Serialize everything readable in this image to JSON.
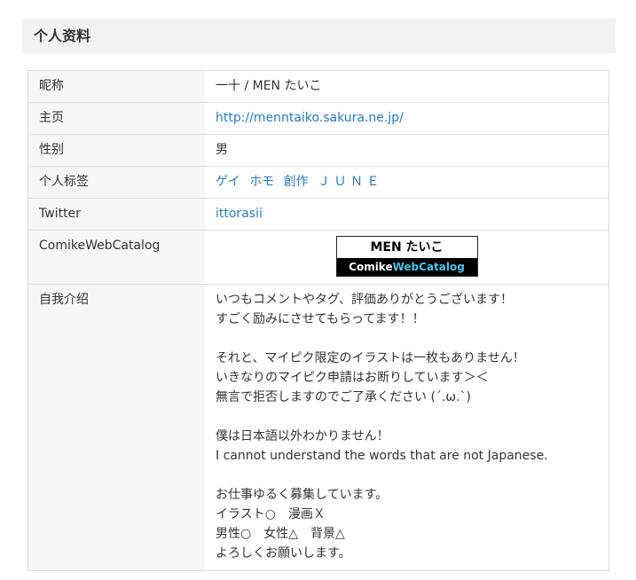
{
  "section": {
    "title": "个人资料"
  },
  "profile": {
    "nickname_label": "昵称",
    "nickname_value": "一十 / MEN たいこ",
    "homepage_label": "主页",
    "homepage_value": "http://menntaiko.sakura.ne.jp/",
    "gender_label": "性别",
    "gender_value": "男",
    "tags_label": "个人标签",
    "tags": [
      "ゲイ",
      "ホモ",
      "創作",
      "Ｊ Ｕ Ｎ Ｅ"
    ],
    "twitter_label": "Twitter",
    "twitter_value": "ittorasii",
    "catalog_label": "ComikeWebCatalog",
    "catalog_badge": {
      "name": "MEN たいこ",
      "brand_part1": "Comike",
      "brand_part2": "WebCatalog"
    },
    "intro_label": "自我介绍",
    "intro_lines": [
      "いつもコメントやタグ、評価ありがとうございます！",
      "すごく励みにさせてもらってます！！",
      "",
      "それと、マイピク限定のイラストは一枚もありません！",
      "いきなりのマイピク申請はお断りしています＞＜",
      "無言で拒否しますのでご了承ください (´.ω.`)",
      "",
      "僕は日本語以外わかりません！",
      "I cannot understand the words that are not Japanese.",
      "",
      "お仕事ゆるく募集しています。",
      "イラスト○　漫画Ｘ",
      "男性○　女性△　背景△",
      "よろしくお願いします。"
    ]
  },
  "colors": {
    "link": "#2b7ab5",
    "label_bg": "#f7f7f7",
    "header_bg": "#f2f2f2",
    "badge_accent": "#4fc3e8"
  }
}
